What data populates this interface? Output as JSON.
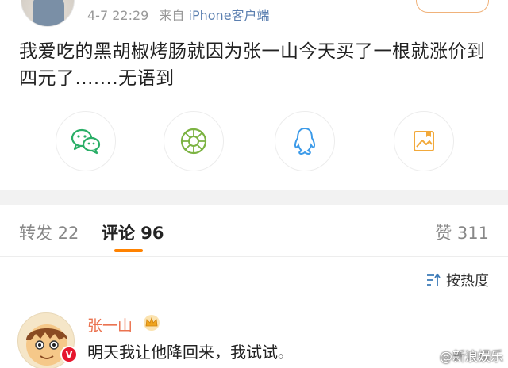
{
  "post": {
    "meta_time": "4-7 22:29",
    "meta_source_prefix": "来自",
    "meta_source": "iPhone客户端",
    "text": "我爱吃的黑胡椒烤肠就因为张一山今天买了一根就涨价到四元了.......无语到"
  },
  "share_icons": [
    "wechat-icon",
    "moments-icon",
    "qq-icon",
    "qzone-image-icon"
  ],
  "tabs": {
    "repost": "转发 22",
    "comments": "评论 96",
    "likes": "赞 311"
  },
  "sort_label": "按热度",
  "comment": {
    "name": "张一山",
    "text": "明天我让他降回来，我试试。",
    "badge": "V"
  },
  "watermark": "@新浪娱乐",
  "colors": {
    "accent": "#ff8200",
    "username": "#eb7350",
    "wechat": "#2aae67",
    "moments": "#7cb342",
    "qq": "#3d9be9",
    "qzone": "#f2a93b",
    "verified": "#e6162d"
  }
}
